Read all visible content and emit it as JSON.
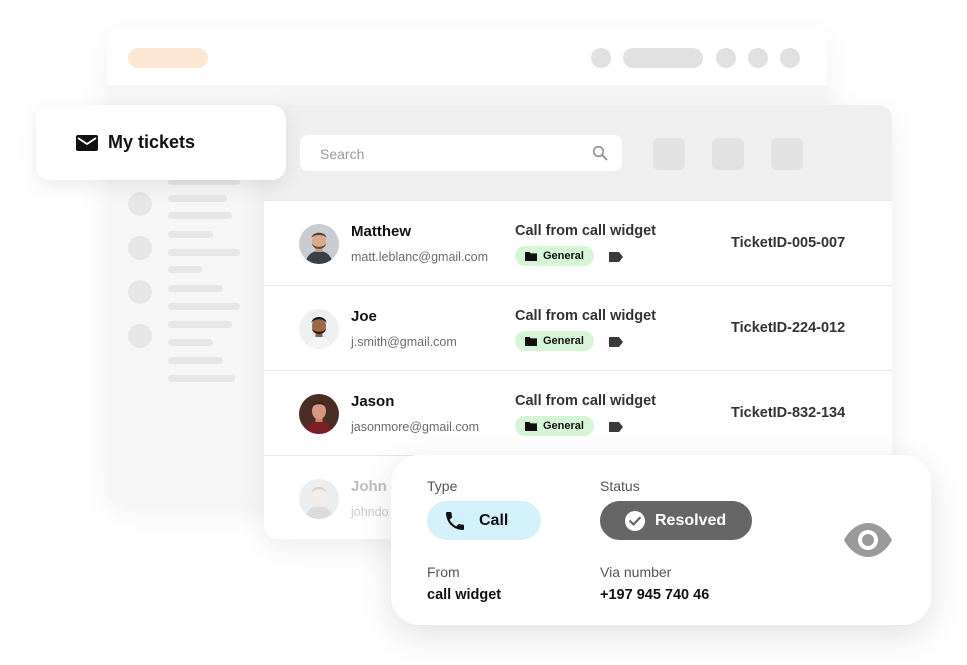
{
  "my_tickets": {
    "label": "My tickets",
    "icon": "envelope-icon"
  },
  "search": {
    "placeholder": "Search",
    "icon": "search-icon"
  },
  "tickets": [
    {
      "name": "Matthew",
      "email": "matt.leblanc@gmail.com",
      "subject": "Call from call widget",
      "tag": "General",
      "ticket_id": "TicketID-005-007"
    },
    {
      "name": "Joe",
      "email": "j.smith@gmail.com",
      "subject": "Call from call widget",
      "tag": "General",
      "ticket_id": "TicketID-224-012"
    },
    {
      "name": "Jason",
      "email": "jasonmore@gmail.com",
      "subject": "Call from call widget",
      "tag": "General",
      "ticket_id": "TicketID-832-134"
    },
    {
      "name": "John",
      "email": "johndo"
    }
  ],
  "detail": {
    "type_label": "Type",
    "type_value": "Call",
    "status_label": "Status",
    "status_value": "Resolved",
    "from_label": "From",
    "from_value": "call widget",
    "via_label": "Via number",
    "via_value": "+197 945 740 46"
  },
  "colors": {
    "accent_orange": "#fde6d2",
    "tag_green": "#d6f5d6",
    "type_blue": "#d3f1fb",
    "status_grey": "#666666"
  }
}
